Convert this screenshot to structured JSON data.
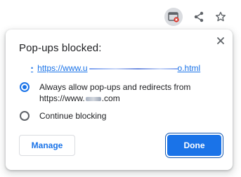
{
  "toolbar": {
    "icons": [
      "popup-blocked-icon",
      "share-icon",
      "bookmark-star-icon"
    ]
  },
  "popup": {
    "title": "Pop-ups blocked:",
    "blocked_url_prefix": "https://www.u",
    "blocked_url_suffix": "o.html",
    "options": [
      {
        "line1": "Always allow pop-ups and redirects from",
        "line2_prefix": "https://www.",
        "line2_suffix": ".com",
        "checked": true
      },
      {
        "line1": "Continue blocking",
        "checked": false
      }
    ],
    "manage_label": "Manage",
    "done_label": "Done"
  },
  "colors": {
    "accent": "#1a73e8",
    "text": "#202124",
    "icon": "#5f6368"
  }
}
